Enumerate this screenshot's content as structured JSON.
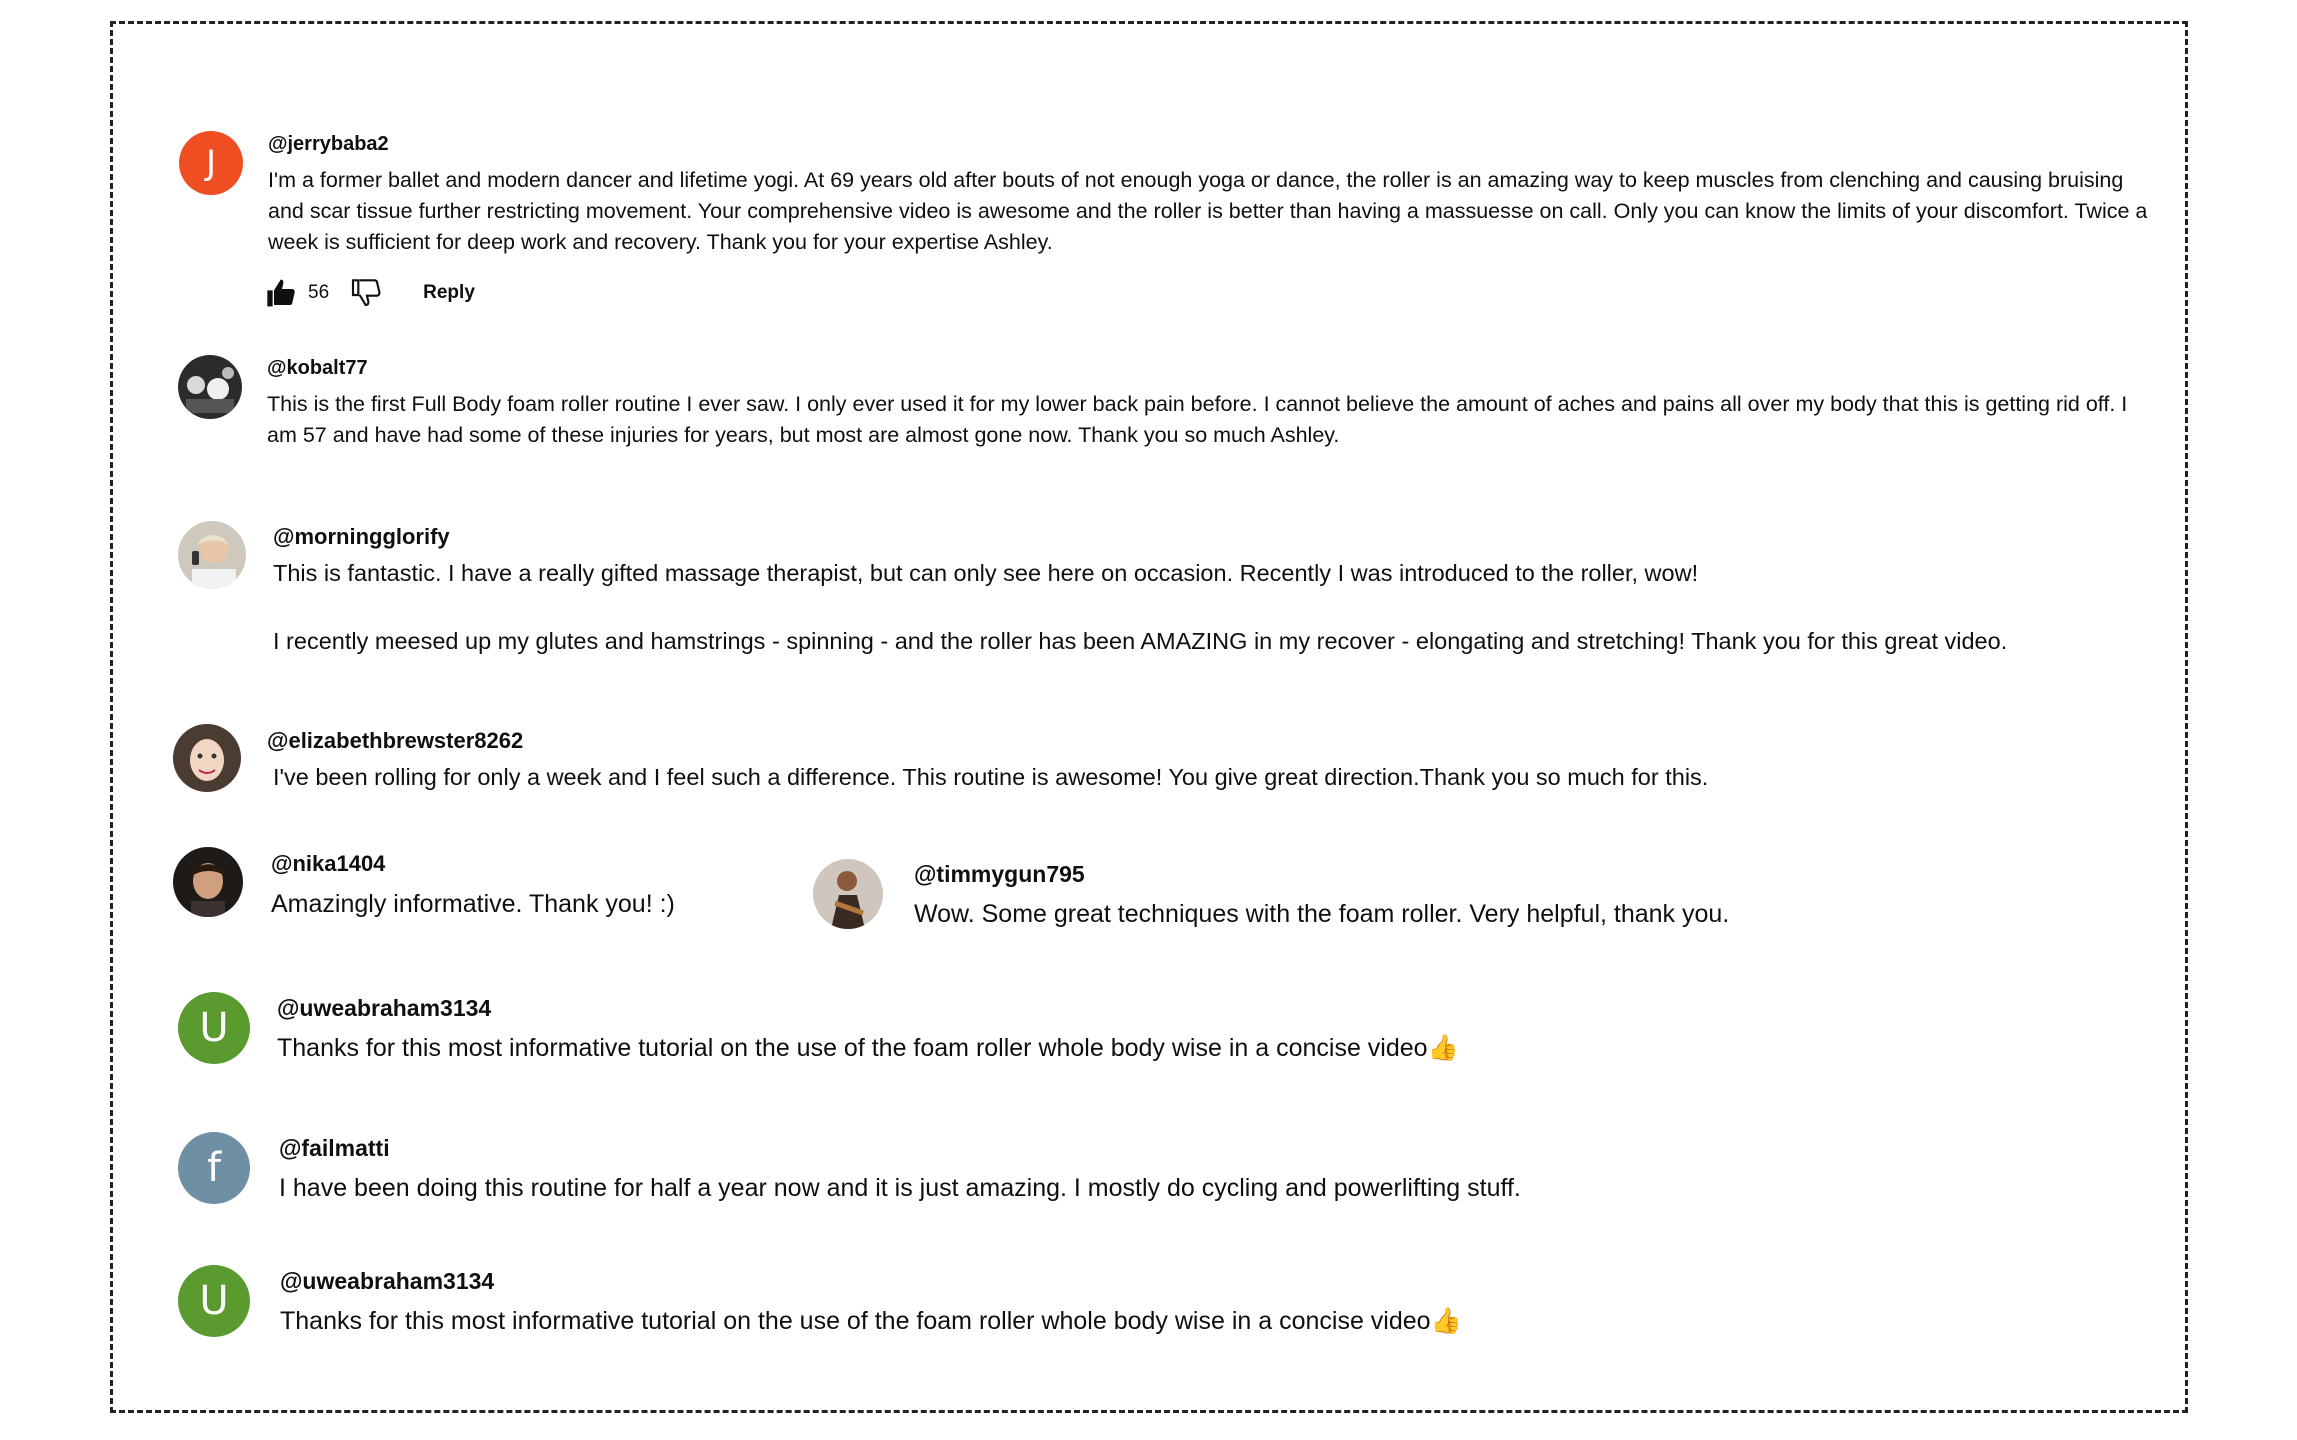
{
  "colors": {
    "frame_border": "#222222",
    "text": "#0f0f0f",
    "avatar_orange": "#ee4e22",
    "avatar_green": "#5a9a2e",
    "avatar_slate": "#6f8fa5"
  },
  "comments": [
    {
      "handle": "@jerrybaba2",
      "avatar_letter": "J",
      "text": "I'm a former ballet and modern dancer and lifetime yogi.  At 69 years old after bouts of not enough yoga or dance, the roller is an amazing way to keep muscles from clenching and causing bruising and scar tissue further restricting movement.  Your comprehensive video is awesome and the roller is better than having a massuesse on call.  Only you can know the limits of your discomfort.  Twice a week is sufficient for deep work and recovery.  Thank you for your expertise Ashley.",
      "like_count": "56",
      "reply_label": "Reply",
      "icons": [
        "thumbs-up-icon",
        "thumbs-down-icon"
      ]
    },
    {
      "handle": "@kobalt77",
      "avatar_icon": "photo-avatar",
      "text": "This is the first Full Body foam roller routine I ever saw. I only ever used it for my lower back pain before. I cannot believe the amount of aches and pains all over my body that this is getting rid off.  I am 57 and have had some of these injuries for years, but most are almost gone now. Thank you so much Ashley."
    },
    {
      "handle": "@morningglorify",
      "avatar_icon": "photo-avatar",
      "text_p1": "This is fantastic. I have a really gifted massage therapist, but can only see here on occasion. Recently I was introduced to the roller, wow!",
      "text_p2": "I recently meesed up my glutes and hamstrings - spinning - and the roller has been AMAZING in my recover - elongating and stretching!  Thank you for this great video."
    },
    {
      "handle": "@elizabethbrewster8262",
      "avatar_icon": "photo-avatar",
      "text": "I've been rolling for only a week and I feel such a difference. This routine is awesome! You give great direction.Thank you so much for this."
    },
    {
      "handle": "@nika1404",
      "avatar_icon": "photo-avatar",
      "text": "Amazingly informative. Thank you! :)"
    },
    {
      "handle": "@timmygun795",
      "avatar_icon": "photo-avatar",
      "text": "Wow. Some great techniques with the foam roller. Very helpful, thank you."
    },
    {
      "handle": "@uweabraham3134",
      "avatar_letter": "U",
      "text": "Thanks for this most informative tutorial on the use of the foam roller whole body wise in a concise video",
      "emoji": "👍"
    },
    {
      "handle": "@failmatti",
      "avatar_letter": "f",
      "text": "I have been doing this routine for half a year now and it is just amazing. I mostly do cycling and powerlifting stuff."
    },
    {
      "handle": "@uweabraham3134",
      "avatar_letter": "U",
      "text": "Thanks for this most informative tutorial on the use of the foam roller whole body wise in a concise video",
      "emoji": "👍"
    }
  ]
}
